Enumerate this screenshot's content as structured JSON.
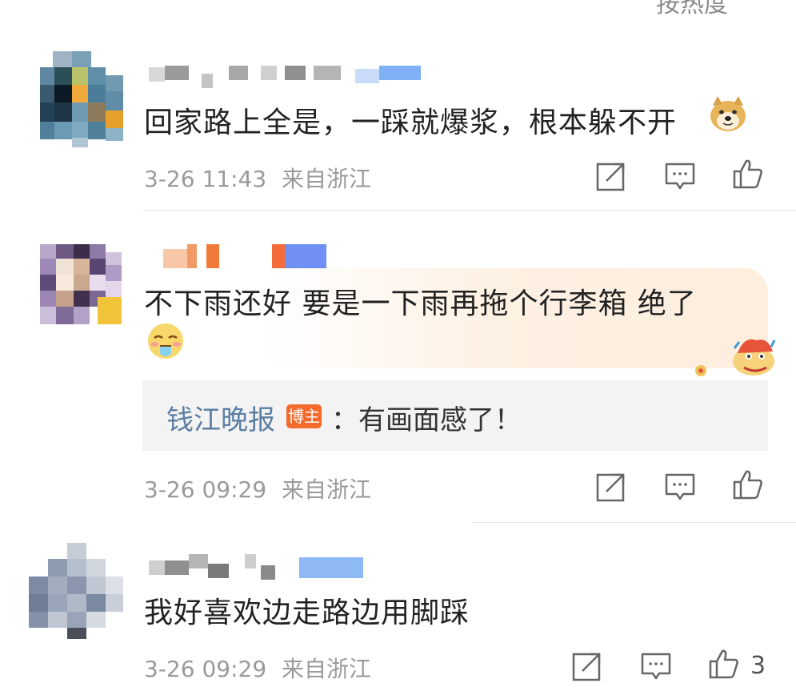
{
  "header": {
    "sort_label": "按热度"
  },
  "comments": [
    {
      "text": "回家路上全是，一踩就爆浆，根本躲不开",
      "time": "3-26 11:43",
      "location": "来自浙江",
      "emoji": "doge-emoji"
    },
    {
      "text_line1": "不下雨还好 要是一下雨再拖个行李箱 绝了",
      "emoji": "drooling-face-emoji",
      "reply": {
        "author": "钱江晚报",
        "badge": "博主",
        "text": "：有画面感了！"
      },
      "time": "3-26 09:29",
      "location": "来自浙江"
    },
    {
      "text": "我好喜欢边走路边用脚踩",
      "time": "3-26 09:29",
      "location": "来自浙江",
      "likes": "3"
    }
  ],
  "colors": {
    "meta": "#9a9a9a",
    "reply_author": "#5b7ea3",
    "badge": "#f36a2d"
  },
  "icons": [
    "share-icon",
    "comment-icon",
    "like-icon"
  ]
}
